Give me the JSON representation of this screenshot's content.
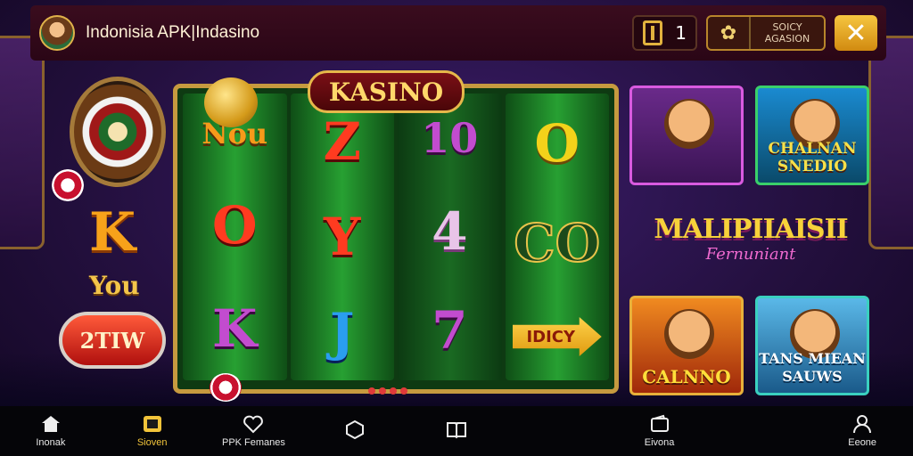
{
  "header": {
    "app_title": "Indonisia APK|Indasino",
    "counter_value": "1",
    "settings_label": "SOICY AGASION"
  },
  "slot": {
    "banner": "KASINO",
    "reels": [
      [
        "Nou",
        "O",
        "K"
      ],
      [
        "Z",
        "Y",
        "J"
      ],
      [
        "10",
        "4",
        "7"
      ],
      [
        "O",
        "CO",
        "IDICY"
      ]
    ]
  },
  "left_panel": {
    "big_symbol": "K",
    "you_label": "You",
    "spin_label": "2TIW"
  },
  "tiles": [
    {
      "label": ""
    },
    {
      "label": "CHALNAN SNEDIO"
    },
    {
      "label": "CALNNO"
    },
    {
      "label": "TANS MIEAN SAUWS"
    }
  ],
  "promo": {
    "title": "MALIPIIAISII",
    "subtitle": "Fernuniant"
  },
  "nav": {
    "items": [
      {
        "label": "Inonak",
        "icon": "home-icon"
      },
      {
        "label": "Sioven",
        "icon": "slot-icon"
      },
      {
        "label": "PPK Femanes",
        "icon": "heart-icon"
      },
      {
        "label": "",
        "icon": "hexagon-icon"
      },
      {
        "label": "",
        "icon": "book-icon"
      },
      {
        "label": "Eivona",
        "icon": "wallet-icon"
      },
      {
        "label": "Eeone",
        "icon": "user-icon"
      }
    ]
  },
  "colors": {
    "header_bg": "#2a0616",
    "accent_gold": "#f2c43a",
    "reel_green": "#27a032"
  }
}
